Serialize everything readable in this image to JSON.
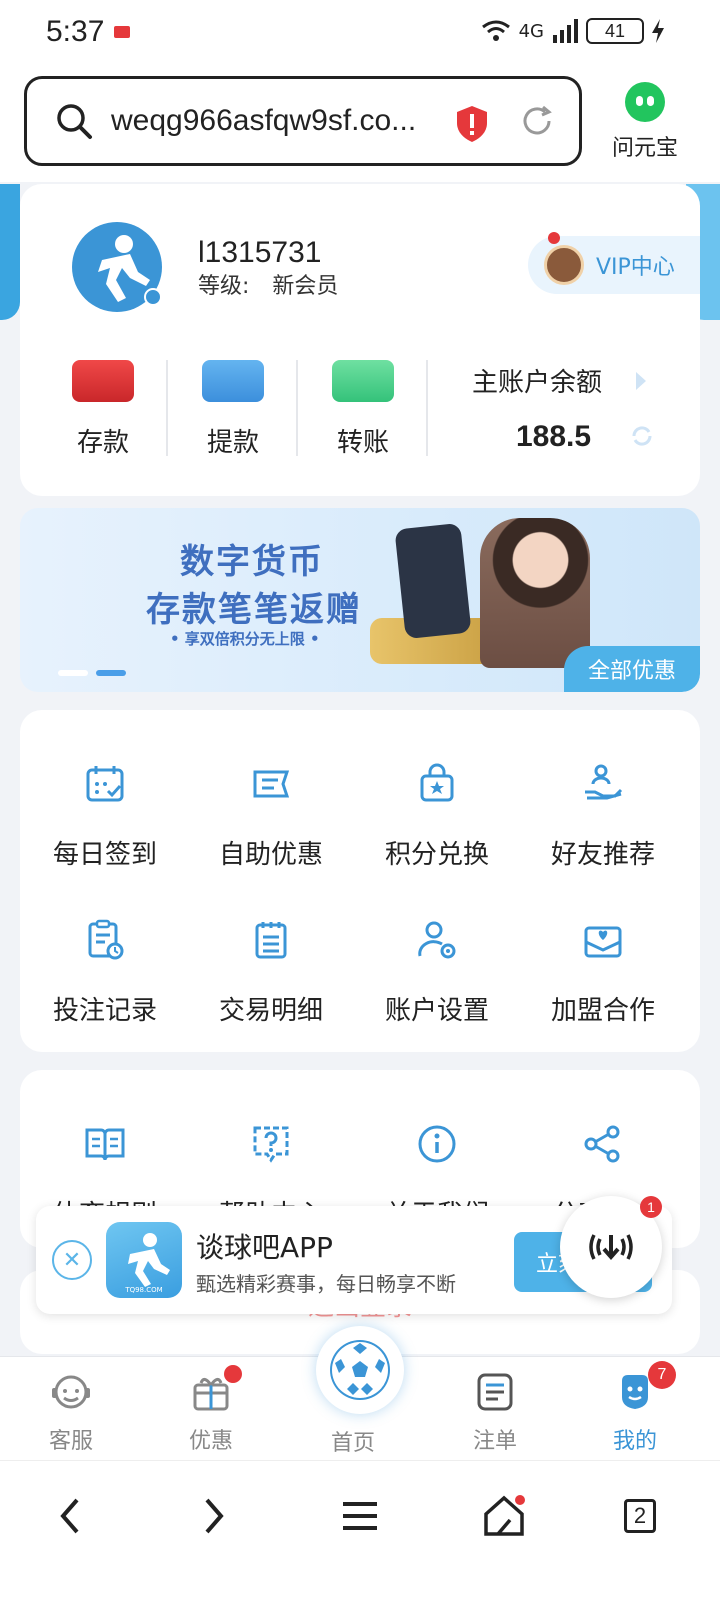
{
  "status_bar": {
    "time": "5:37",
    "network": "4G",
    "battery": "41"
  },
  "browser": {
    "url": "weqg966asfqw9sf.co...",
    "assistant_label": "问元宝"
  },
  "profile": {
    "username": "l1315731",
    "level_label": "等级:",
    "level_value": "新会员",
    "vip_label": "VIP中心"
  },
  "actions": [
    {
      "label": "存款",
      "icon": "wallet-icon"
    },
    {
      "label": "提款",
      "icon": "card-icon"
    },
    {
      "label": "转账",
      "icon": "transfer-icon"
    }
  ],
  "balance": {
    "title": "主账户余额",
    "value": "188.5"
  },
  "banner": {
    "line1": "数字货币",
    "line2": "存款笔笔返赠",
    "line3": "• 享双倍积分无上限 •",
    "all_offers": "全部优惠",
    "active_slide": 2,
    "slide_count": 2
  },
  "menu_primary": [
    {
      "label": "每日签到",
      "icon": "calendar-check-icon"
    },
    {
      "label": "自助优惠",
      "icon": "ticket-icon"
    },
    {
      "label": "积分兑换",
      "icon": "gift-bag-icon"
    },
    {
      "label": "好友推荐",
      "icon": "hand-person-icon"
    },
    {
      "label": "投注记录",
      "icon": "clipboard-clock-icon"
    },
    {
      "label": "交易明细",
      "icon": "notepad-icon"
    },
    {
      "label": "账户设置",
      "icon": "user-gear-icon"
    },
    {
      "label": "加盟合作",
      "icon": "mail-heart-icon"
    }
  ],
  "menu_secondary": [
    {
      "label": "体育规则",
      "icon": "book-icon"
    },
    {
      "label": "帮助中心",
      "icon": "question-bubble-icon"
    },
    {
      "label": "关于我们",
      "icon": "info-icon"
    },
    {
      "label": "分享APP",
      "icon": "share-icon"
    }
  ],
  "logout_label": "退出登录",
  "app_promo": {
    "title": "谈球吧APP",
    "subtitle": "甄选精彩赛事，每日畅享不断",
    "button": "立刻",
    "logo_text": "TQ98.COM",
    "float_badge": "1"
  },
  "tabbar": [
    {
      "label": "客服",
      "icon": "headset-icon"
    },
    {
      "label": "优惠",
      "icon": "gift-icon"
    },
    {
      "label": "首页",
      "icon": "soccer-ball-icon"
    },
    {
      "label": "注单",
      "icon": "list-doc-icon"
    },
    {
      "label": "我的",
      "icon": "user-icon",
      "badge": "7"
    }
  ],
  "navbar": {
    "tabs_count": "2"
  },
  "colors": {
    "accent": "#3b95d6",
    "danger": "#e5383b",
    "promo_blue": "#4eb2e8"
  }
}
